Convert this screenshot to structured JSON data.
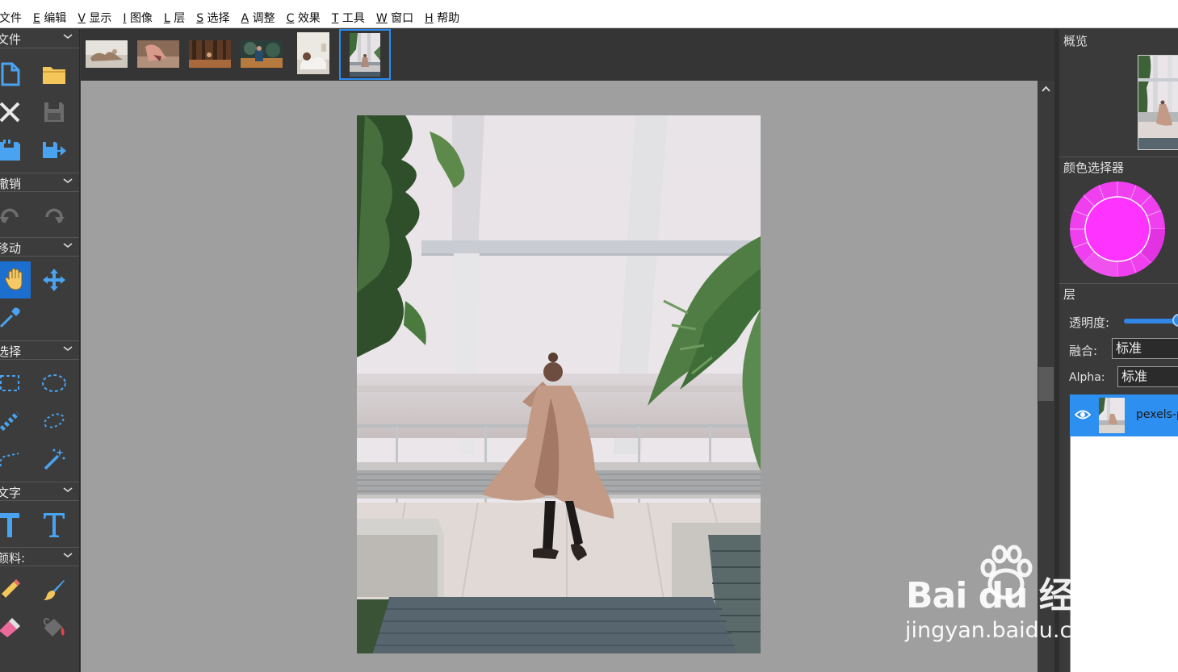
{
  "menu": {
    "items": [
      {
        "key": "",
        "label": "文件"
      },
      {
        "key": "E",
        "label": "编辑"
      },
      {
        "key": "V",
        "label": "显示"
      },
      {
        "key": "I",
        "label": "图像"
      },
      {
        "key": "L",
        "label": "层"
      },
      {
        "key": "S",
        "label": "选择"
      },
      {
        "key": "A",
        "label": "调整"
      },
      {
        "key": "C",
        "label": "效果"
      },
      {
        "key": "T",
        "label": "工具"
      },
      {
        "key": "W",
        "label": "窗口"
      },
      {
        "key": "H",
        "label": "帮助"
      }
    ]
  },
  "toolbox": {
    "sections": [
      {
        "label": "文件",
        "tools": [
          "new-file-icon",
          "open-folder-icon",
          "close-icon",
          "save-icon",
          "save-as-icon",
          "export-icon"
        ]
      },
      {
        "label": "撤销",
        "tools": [
          "undo-icon",
          "redo-icon"
        ]
      },
      {
        "label": "移动",
        "tools": [
          "hand-pan-icon",
          "move-arrows-icon",
          "eyedropper-icon"
        ]
      },
      {
        "label": "选择",
        "tools": [
          "rect-select-icon",
          "ellipse-select-icon",
          "line-select-icon",
          "lasso-icon",
          "polygon-lasso-icon",
          "magic-wand-icon"
        ]
      },
      {
        "label": "文字",
        "tools": [
          "text-bold-icon",
          "text-serif-icon"
        ]
      },
      {
        "label": "颜料:",
        "tools": [
          "pencil-icon",
          "brush-icon",
          "eraser-icon",
          "paint-bucket-icon"
        ]
      }
    ],
    "active_tool": "hand-pan-icon"
  },
  "thumbnails": {
    "count": 6,
    "selected_index": 5
  },
  "right_panel": {
    "overview_title": "概览",
    "color_picker_title": "颜色选择器",
    "current_color": "#ff33ff",
    "layers_title": "层",
    "opacity_label": "透明度:",
    "opacity_value": 1.0,
    "blend_label": "融合:",
    "blend_value": "标准",
    "alpha_label": "Alpha:",
    "alpha_value": "标准",
    "layer_name": "pexels-p"
  },
  "watermark": {
    "brand": "Bai du 经验",
    "url": "jingyan.baidu.com"
  },
  "colors": {
    "accent": "#2d8ff0",
    "tool_icon": "#4aa3f0",
    "folder": "#f3c75a",
    "canvas_bg": "#9f9f9f",
    "panel_bg": "#3a3a3a"
  }
}
